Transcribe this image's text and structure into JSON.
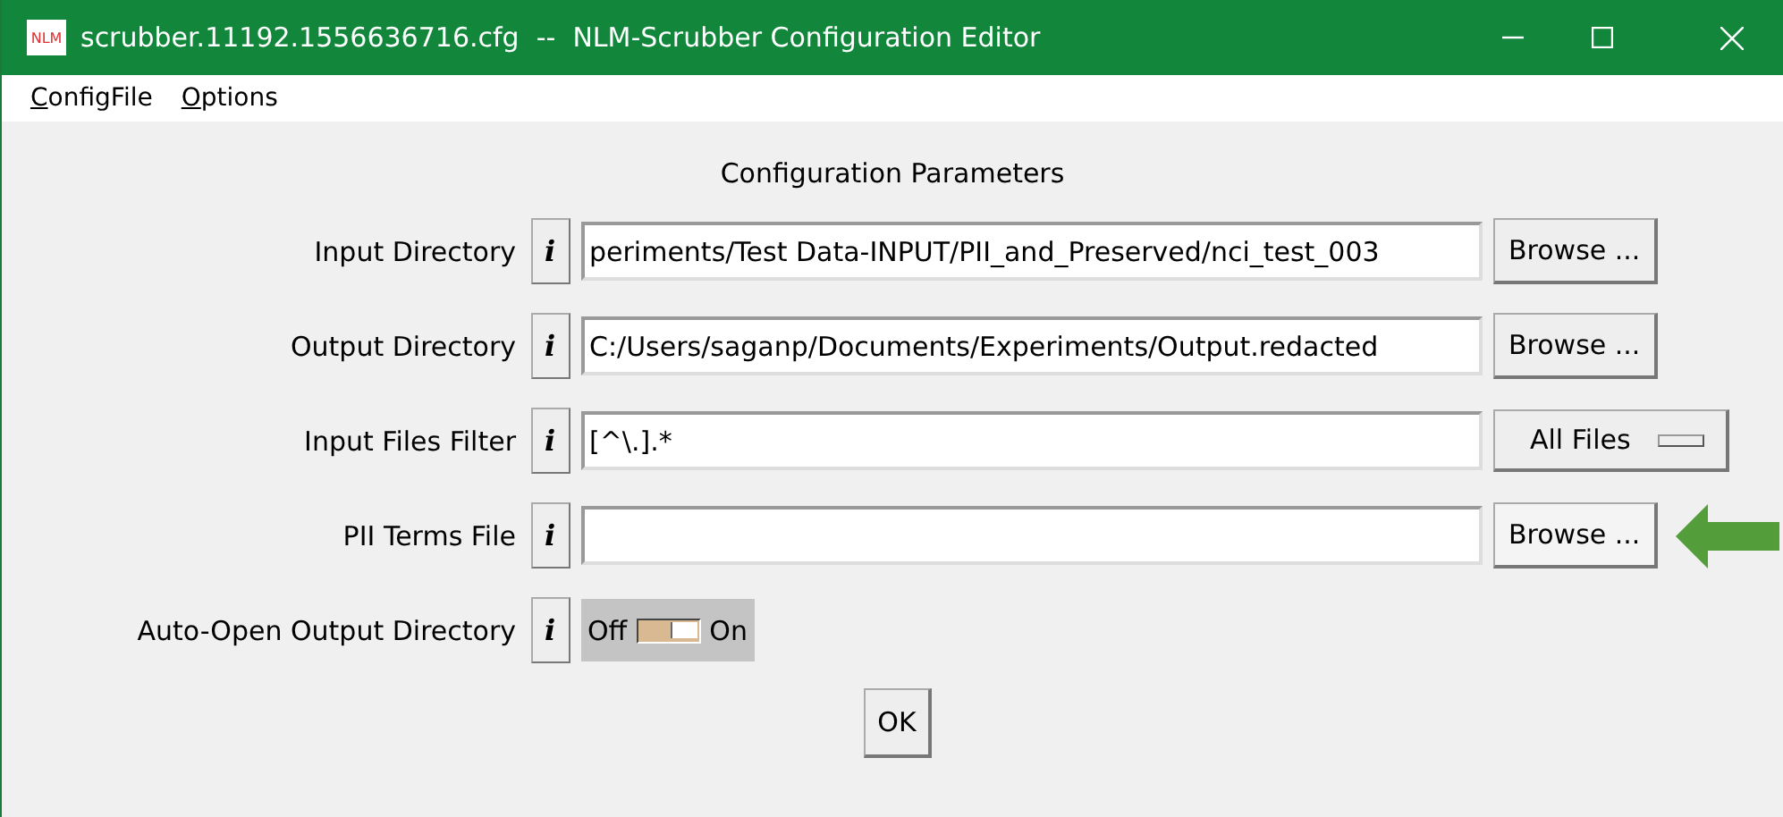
{
  "window": {
    "title": "scrubber.11192.1556636716.cfg  --  NLM-Scrubber Configuration Editor",
    "app_badge": "NLM"
  },
  "menu": [
    {
      "label": "ConfigFile",
      "first_letter_underlined": true
    },
    {
      "label": "Options",
      "first_letter_underlined": true
    }
  ],
  "heading": "Configuration Parameters",
  "rows": [
    {
      "kind": "path",
      "label": "Input Directory",
      "info": "i",
      "value": "periments/Test Data-INPUT/PII_and_Preserved/nci_test_003",
      "button": "Browse ..."
    },
    {
      "kind": "path",
      "label": "Output Directory",
      "info": "i",
      "value": "C:/Users/saganp/Documents/Experiments/Output.redacted",
      "button": "Browse ..."
    },
    {
      "kind": "filter",
      "label": "Input Files Filter",
      "info": "i",
      "value": "[^\\.].*",
      "menu_button": "All Files"
    },
    {
      "kind": "path",
      "label": "PII Terms File",
      "info": "i",
      "button": "Browse ...",
      "highlighted": true
    },
    {
      "kind": "switch",
      "label": "Auto-Open Output Directory",
      "info": "i",
      "off_label": "Off",
      "on_label": "On",
      "on": true
    }
  ],
  "ok_button": "OK"
}
